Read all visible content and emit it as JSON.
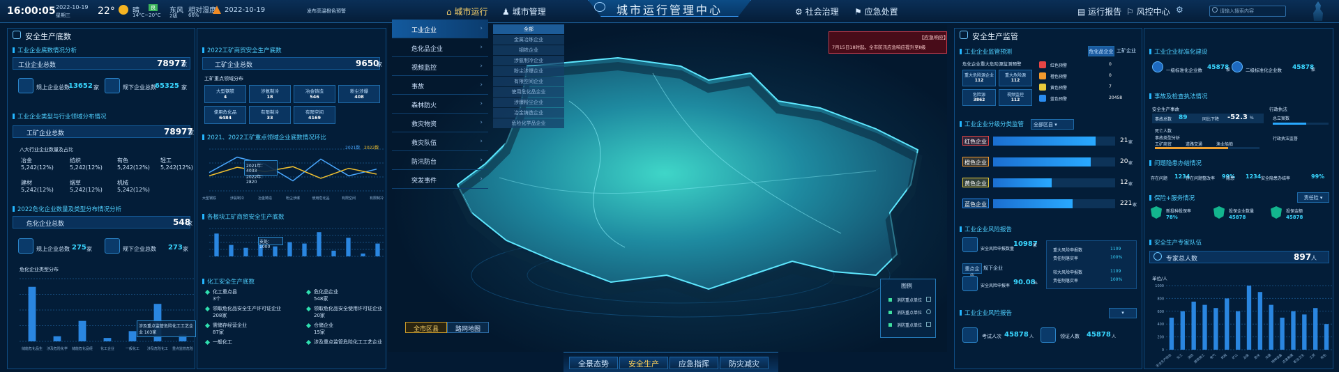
{
  "topbar": {
    "time": "16:00:05",
    "date": "2022-10-19",
    "weekday": "星期三",
    "temperature": "22°",
    "weather": "晴",
    "aqi": "良",
    "temp_range": "14°C~20°C",
    "wind": "东风",
    "wind_level": "2级",
    "humidity_label": "相对湿度",
    "humidity": "66%",
    "warning_date": "2022-10-19",
    "warning_text": "发布高温橙色预警",
    "nav_left": [
      "城市运行",
      "城市管理"
    ],
    "title": "城市运行管理中心",
    "nav_right": [
      "社会治理",
      "应急处置"
    ],
    "nav_far": [
      "运行报告",
      "风控中心"
    ],
    "search_placeholder": "请输入搜索内容"
  },
  "left": {
    "title": "安全生产底数",
    "s1": {
      "title": "工业企业底数情况分析",
      "total_label": "工业企业总数",
      "total": "78977",
      "unit": "家",
      "above_label": "规上企业总数",
      "above": "13652",
      "below_label": "规下企业总数",
      "below": "65325"
    },
    "s2": {
      "title": "工业企业类型与行业领域分布情况",
      "total_label": "工矿企业总数",
      "total": "78977",
      "unit": "家",
      "sub": "八大行业企业数量及占比",
      "items": [
        {
          "name": "冶金",
          "value": "5,242(12%)"
        },
        {
          "name": "纺织",
          "value": "5,242(12%)"
        },
        {
          "name": "有色",
          "value": "5,242(12%)"
        },
        {
          "name": "轻工",
          "value": "5,242(12%)"
        },
        {
          "name": "建材",
          "value": "5,242(12%)"
        },
        {
          "name": "烟草",
          "value": "5,242(12%)"
        },
        {
          "name": "机械",
          "value": "5,242(12%)"
        }
      ]
    },
    "s3": {
      "title": "2022危化企业数量及类型分布情况分析",
      "total_label": "危化企业总数",
      "total": "548",
      "unit": "家",
      "above_label": "规上企业总数",
      "above": "275",
      "below_label": "规下企业总数",
      "below": "273",
      "chart_title": "危化企业类型分布",
      "tooltip": "涉及重点监管危险化工工艺企业 103家",
      "labels": [
        "储能危化品生产企业",
        "涉及危险化学品生产许可证企业",
        "储能危化品经营企业",
        "化工企业",
        "一般化工",
        "涉及危险化工工艺企业",
        "重点监管危险化学品企业"
      ]
    }
  },
  "left2": {
    "s1": {
      "title": "2022工矿商贸安全生产底数",
      "total_label": "工矿企业总数",
      "total": "9650",
      "unit": "家",
      "sub": "工矿重点领域分布",
      "tags": [
        {
          "name": "大型钢铁",
          "value": "4"
        },
        {
          "name": "涉氨制冷",
          "value": "18"
        },
        {
          "name": "冶金铸造",
          "value": "546"
        },
        {
          "name": "粉尘涉爆",
          "value": "408"
        },
        {
          "name": "使用危化品",
          "value": "6484"
        },
        {
          "name": "有限制冷",
          "value": "33"
        },
        {
          "name": "有限空间",
          "value": "4169"
        }
      ]
    },
    "s2": {
      "title": "2021、2022工矿重点领域企业底数情况环比",
      "legend": [
        "2021数",
        "2022数"
      ],
      "tooltip": [
        "2021年：4033",
        "2022年：2820"
      ]
    },
    "s3": {
      "title": "各板块工矿商贸安全生产底数",
      "tooltip": "支处：1000"
    },
    "s4": {
      "title": "化工安全生产底数",
      "items": [
        {
          "name": "化工重点县",
          "value": "3个"
        },
        {
          "name": "危化品企业",
          "value": "548家"
        },
        {
          "name": "领取危化品安全生产许可证企业",
          "value": "208家"
        },
        {
          "name": "领取危化品安全使用许可证企业",
          "value": "20家"
        },
        {
          "name": "需储存经营企业",
          "value": "87家"
        },
        {
          "name": "仓储企业",
          "value": "15家"
        },
        {
          "name": "一般化工",
          "value": ""
        },
        {
          "name": "涉及重点监管危险化工工艺企业",
          "value": ""
        }
      ]
    }
  },
  "menu": {
    "items": [
      "工业企业",
      "危化品企业",
      "视频监控",
      "事故",
      "森林防火",
      "救灾物资",
      "救灾队伍",
      "防汛防台",
      "突发事件"
    ],
    "sub": [
      "全部",
      "金属冶炼企业",
      "钢铁企业",
      "涉氨制冷企业",
      "粉尘涉爆企业",
      "有限空间企业",
      "使用危化品企业",
      "涉爆粉尘企业",
      "冶金铸造企业",
      "危险化学品企业"
    ]
  },
  "map": {
    "toggle": [
      "全市区县",
      "路网地图"
    ],
    "legend_title": "图例",
    "legend": [
      "消防重点单位",
      "消防重点单位",
      "消防重点单位"
    ],
    "bottom": [
      "全景态势",
      "安全生产",
      "应急指挥",
      "防灾减灾"
    ],
    "alert_title": "【应急响应】",
    "alert_text": "7月15日18时起，全市防汛应急响应提升至Ⅱ级"
  },
  "right": {
    "title": "安全生产监管",
    "s1": {
      "title": "工业企业监管预测",
      "tabs": [
        "危化品企业",
        "工矿企业"
      ],
      "sub": "危化企业重大危险源监测预警",
      "boxes": [
        {
          "name": "重大危险源企业",
          "value": "112"
        },
        {
          "name": "重大危险源",
          "value": "112"
        },
        {
          "name": "危险源",
          "value": "3862"
        },
        {
          "name": "视频监控",
          "value": "112"
        }
      ],
      "alarms": [
        {
          "name": "红色预警",
          "value": "0"
        },
        {
          "name": "橙色预警",
          "value": "0"
        },
        {
          "name": "黄色预警",
          "value": "7"
        },
        {
          "name": "蓝色预警",
          "value": "20458"
        }
      ]
    },
    "s2": {
      "title": "工业企业分级分类监管",
      "select": "全部区县",
      "rows": [
        {
          "name": "红色企业",
          "value": 21,
          "color": "#e84545"
        },
        {
          "name": "橙色企业",
          "value": 20,
          "color": "#f39a2e"
        },
        {
          "name": "黄色企业",
          "value": 12,
          "color": "#e8c93b"
        },
        {
          "name": "蓝色企业",
          "value": 221,
          "color": "#2a8cf0"
        }
      ],
      "unit": "家"
    },
    "s3": {
      "title": "工业企业风险报告",
      "label1": "安全风险申报数量",
      "value1": "10987",
      "unit1": "家",
      "items": [
        {
          "name": "重大风险申报数",
          "value": "1109"
        },
        {
          "name": "责任制落实率",
          "value": "100%"
        },
        {
          "name": "较大风险申报数",
          "value": "1109"
        },
        {
          "name": "责任制落实率",
          "value": "100%"
        }
      ],
      "tabs": [
        "重点企业",
        "规下企业"
      ],
      "label2": "安全风险申报率",
      "value2": "90.08",
      "unit2": "%"
    },
    "s4": {
      "title": "工业企业风险报告",
      "exam_label": "考试人次",
      "exam": "45878",
      "cert_label": "领证人数",
      "cert": "45878",
      "unit": "人"
    }
  },
  "right2": {
    "s1": {
      "title": "工业企业标准化建设",
      "a_label": "一级标准化企业数",
      "a": "45878",
      "b_label": "二级标准化企业数",
      "b": "45878",
      "unit": "家"
    },
    "s2": {
      "title": "事故及检查执法情况",
      "sub1": "安全生产事故",
      "sub2": "行政执法",
      "acc_label": "事故总数",
      "acc": "89",
      "yoy_label": "同比下降",
      "yoy": "-52.3",
      "yoy_unit": "%",
      "dead_label": "死亡人数",
      "row2": [
        "事故类型分析",
        "工矿商贸",
        "道路交通",
        "渔业船舶"
      ],
      "law": [
        "总立案数",
        "行政执法监督"
      ]
    },
    "s3": {
      "title": "问题隐患办结情况",
      "items": [
        {
          "name": "存在问题",
          "value": "1234"
        },
        {
          "name": "存在问题整改率",
          "value": "99%"
        },
        {
          "name": "隐患",
          "value": "1234"
        },
        {
          "name": "安全隐患办结率",
          "value": "99%"
        }
      ]
    },
    "s4": {
      "title": "保险+服务情况",
      "select": "责任险",
      "items": [
        {
          "name": "新投种投保率",
          "value": "78%"
        },
        {
          "name": "投保企业数量",
          "value": "45878"
        },
        {
          "name": "投保金额",
          "value": "45878"
        }
      ]
    },
    "s5": {
      "title": "安全生产专家队伍",
      "total_label": "专家总人数",
      "total": "897",
      "unit": "人",
      "yunit": "单位/人"
    }
  },
  "chart_data": [
    {
      "type": "bar",
      "title": "",
      "categories": [
        "储能危化品生产企业",
        "涉及危险化学品生产许可证企业",
        "储能危化品经营企业",
        "化工企业",
        "一般化工",
        "涉及危险化工工艺企业",
        "重点监管危险化学品企业"
      ],
      "values": [
        160,
        15,
        60,
        10,
        30,
        110,
        20
      ]
    },
    {
      "type": "line",
      "title": "2021、2022工矿重点领域企业底数情况环比",
      "categories": [
        "大型钢铁",
        "涉氨制冷",
        "冶金铸造",
        "粉尘涉爆",
        "使用危化品",
        "有限空间",
        "有限制冷"
      ],
      "series": [
        {
          "name": "2021数",
          "values": [
            2200,
            4033,
            3200,
            1200,
            3800,
            1800,
            2600
          ]
        },
        {
          "name": "2022数",
          "values": [
            1800,
            2820,
            2300,
            2900,
            1500,
            2700,
            2000
          ]
        }
      ]
    },
    {
      "type": "bar",
      "title": "各板块工矿商贸安全生产底数",
      "categories": [
        "A",
        "B",
        "C",
        "D",
        "E",
        "F",
        "G",
        "H",
        "I",
        "J",
        "K",
        "L"
      ],
      "values": [
        80,
        40,
        30,
        60,
        35,
        50,
        45,
        85,
        20,
        65,
        10,
        45
      ]
    },
    {
      "type": "bar",
      "title": "安全生产专家队伍",
      "categories": [
        "安全生产综合",
        "化工",
        "消防",
        "建筑施工",
        "电气",
        "机械",
        "矿山",
        "冶金",
        "危化",
        "交通",
        "特种设备",
        "应急救援",
        "职业卫生",
        "工贸",
        "有色"
      ],
      "values": [
        500,
        600,
        750,
        700,
        650,
        800,
        600,
        1000,
        900,
        700,
        500,
        600,
        550,
        650,
        400
      ],
      "ylim": [
        0,
        1000
      ]
    }
  ]
}
